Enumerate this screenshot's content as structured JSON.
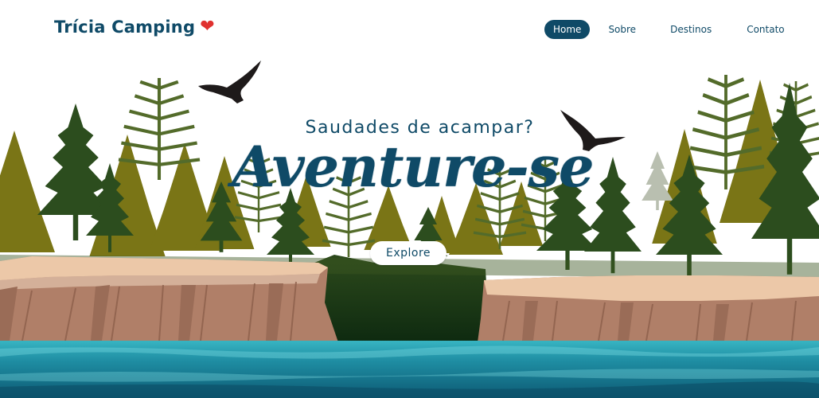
{
  "brand": {
    "name": "Trícia Camping",
    "icon": "heart-icon"
  },
  "nav": {
    "items": [
      {
        "label": "Home",
        "active": true
      },
      {
        "label": "Sobre",
        "active": false
      },
      {
        "label": "Destinos",
        "active": false
      },
      {
        "label": "Contato",
        "active": false
      }
    ]
  },
  "hero": {
    "subtitle": "Saudades de acampar?",
    "title": "Aventure-se",
    "cta_label": "Explore"
  },
  "colors": {
    "primary": "#0f4a67",
    "heart": "#e0312f",
    "olive": "#6b6a10",
    "pine_dark": "#22401c",
    "water": "#1f7f95",
    "cliff": "#a77b64",
    "sand": "#e9c7a8"
  }
}
